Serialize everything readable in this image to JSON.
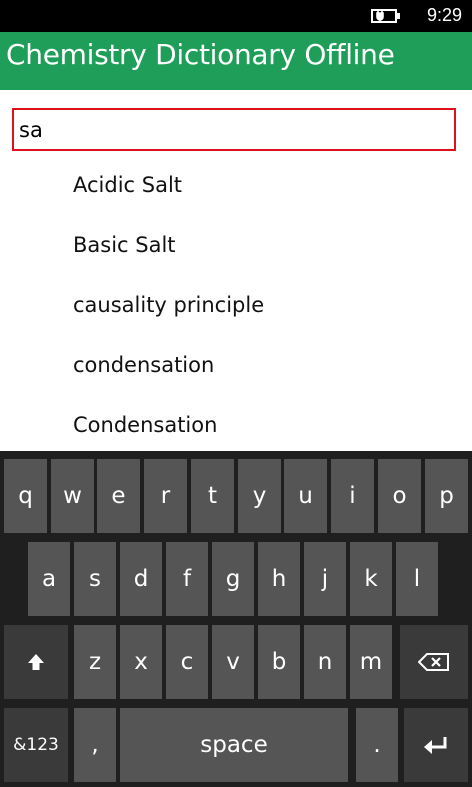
{
  "status": {
    "time": "9:29",
    "battery_icon": "battery-charging-icon"
  },
  "app": {
    "title": "Chemistry Dictionary Offline",
    "accent": "#1e9e58"
  },
  "search": {
    "value": "sa",
    "border_color": "#e0101a"
  },
  "results": [
    "Acidic Salt",
    "Basic Salt",
    "causality principle",
    "condensation",
    "Condensation"
  ],
  "keyboard": {
    "row1": [
      "q",
      "w",
      "e",
      "r",
      "t",
      "y",
      "u",
      "i",
      "o",
      "p"
    ],
    "row2": [
      "a",
      "s",
      "d",
      "f",
      "g",
      "h",
      "j",
      "k",
      "l"
    ],
    "row3": [
      "z",
      "x",
      "c",
      "v",
      "b",
      "n",
      "m"
    ],
    "symbols_label": "&123",
    "comma_label": ",",
    "space_label": "space",
    "period_label": ".",
    "shift_icon": "shift-arrow-icon",
    "backspace_icon": "backspace-icon",
    "enter_icon": "enter-icon"
  }
}
